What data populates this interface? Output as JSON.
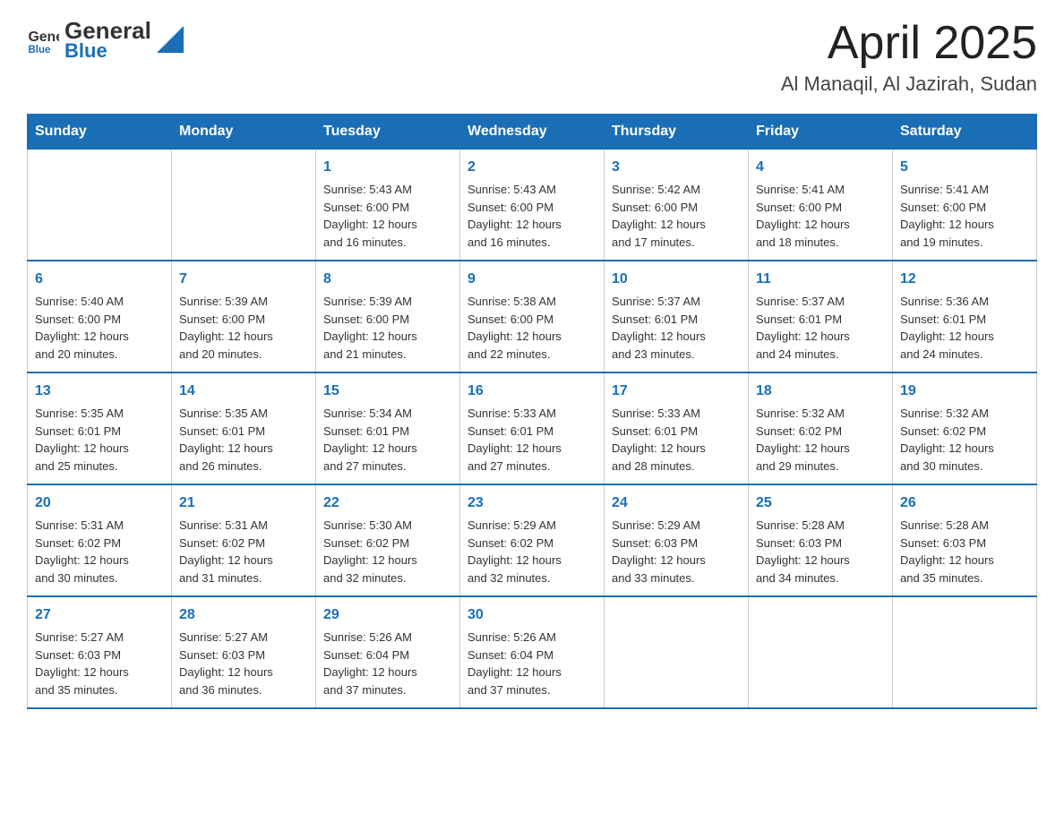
{
  "header": {
    "logo_text_general": "General",
    "logo_text_blue": "Blue",
    "month_title": "April 2025",
    "location": "Al Manaqil, Al Jazirah, Sudan"
  },
  "days_of_week": [
    "Sunday",
    "Monday",
    "Tuesday",
    "Wednesday",
    "Thursday",
    "Friday",
    "Saturday"
  ],
  "weeks": [
    [
      {
        "day": "",
        "info": ""
      },
      {
        "day": "",
        "info": ""
      },
      {
        "day": "1",
        "info": "Sunrise: 5:43 AM\nSunset: 6:00 PM\nDaylight: 12 hours\nand 16 minutes."
      },
      {
        "day": "2",
        "info": "Sunrise: 5:43 AM\nSunset: 6:00 PM\nDaylight: 12 hours\nand 16 minutes."
      },
      {
        "day": "3",
        "info": "Sunrise: 5:42 AM\nSunset: 6:00 PM\nDaylight: 12 hours\nand 17 minutes."
      },
      {
        "day": "4",
        "info": "Sunrise: 5:41 AM\nSunset: 6:00 PM\nDaylight: 12 hours\nand 18 minutes."
      },
      {
        "day": "5",
        "info": "Sunrise: 5:41 AM\nSunset: 6:00 PM\nDaylight: 12 hours\nand 19 minutes."
      }
    ],
    [
      {
        "day": "6",
        "info": "Sunrise: 5:40 AM\nSunset: 6:00 PM\nDaylight: 12 hours\nand 20 minutes."
      },
      {
        "day": "7",
        "info": "Sunrise: 5:39 AM\nSunset: 6:00 PM\nDaylight: 12 hours\nand 20 minutes."
      },
      {
        "day": "8",
        "info": "Sunrise: 5:39 AM\nSunset: 6:00 PM\nDaylight: 12 hours\nand 21 minutes."
      },
      {
        "day": "9",
        "info": "Sunrise: 5:38 AM\nSunset: 6:00 PM\nDaylight: 12 hours\nand 22 minutes."
      },
      {
        "day": "10",
        "info": "Sunrise: 5:37 AM\nSunset: 6:01 PM\nDaylight: 12 hours\nand 23 minutes."
      },
      {
        "day": "11",
        "info": "Sunrise: 5:37 AM\nSunset: 6:01 PM\nDaylight: 12 hours\nand 24 minutes."
      },
      {
        "day": "12",
        "info": "Sunrise: 5:36 AM\nSunset: 6:01 PM\nDaylight: 12 hours\nand 24 minutes."
      }
    ],
    [
      {
        "day": "13",
        "info": "Sunrise: 5:35 AM\nSunset: 6:01 PM\nDaylight: 12 hours\nand 25 minutes."
      },
      {
        "day": "14",
        "info": "Sunrise: 5:35 AM\nSunset: 6:01 PM\nDaylight: 12 hours\nand 26 minutes."
      },
      {
        "day": "15",
        "info": "Sunrise: 5:34 AM\nSunset: 6:01 PM\nDaylight: 12 hours\nand 27 minutes."
      },
      {
        "day": "16",
        "info": "Sunrise: 5:33 AM\nSunset: 6:01 PM\nDaylight: 12 hours\nand 27 minutes."
      },
      {
        "day": "17",
        "info": "Sunrise: 5:33 AM\nSunset: 6:01 PM\nDaylight: 12 hours\nand 28 minutes."
      },
      {
        "day": "18",
        "info": "Sunrise: 5:32 AM\nSunset: 6:02 PM\nDaylight: 12 hours\nand 29 minutes."
      },
      {
        "day": "19",
        "info": "Sunrise: 5:32 AM\nSunset: 6:02 PM\nDaylight: 12 hours\nand 30 minutes."
      }
    ],
    [
      {
        "day": "20",
        "info": "Sunrise: 5:31 AM\nSunset: 6:02 PM\nDaylight: 12 hours\nand 30 minutes."
      },
      {
        "day": "21",
        "info": "Sunrise: 5:31 AM\nSunset: 6:02 PM\nDaylight: 12 hours\nand 31 minutes."
      },
      {
        "day": "22",
        "info": "Sunrise: 5:30 AM\nSunset: 6:02 PM\nDaylight: 12 hours\nand 32 minutes."
      },
      {
        "day": "23",
        "info": "Sunrise: 5:29 AM\nSunset: 6:02 PM\nDaylight: 12 hours\nand 32 minutes."
      },
      {
        "day": "24",
        "info": "Sunrise: 5:29 AM\nSunset: 6:03 PM\nDaylight: 12 hours\nand 33 minutes."
      },
      {
        "day": "25",
        "info": "Sunrise: 5:28 AM\nSunset: 6:03 PM\nDaylight: 12 hours\nand 34 minutes."
      },
      {
        "day": "26",
        "info": "Sunrise: 5:28 AM\nSunset: 6:03 PM\nDaylight: 12 hours\nand 35 minutes."
      }
    ],
    [
      {
        "day": "27",
        "info": "Sunrise: 5:27 AM\nSunset: 6:03 PM\nDaylight: 12 hours\nand 35 minutes."
      },
      {
        "day": "28",
        "info": "Sunrise: 5:27 AM\nSunset: 6:03 PM\nDaylight: 12 hours\nand 36 minutes."
      },
      {
        "day": "29",
        "info": "Sunrise: 5:26 AM\nSunset: 6:04 PM\nDaylight: 12 hours\nand 37 minutes."
      },
      {
        "day": "30",
        "info": "Sunrise: 5:26 AM\nSunset: 6:04 PM\nDaylight: 12 hours\nand 37 minutes."
      },
      {
        "day": "",
        "info": ""
      },
      {
        "day": "",
        "info": ""
      },
      {
        "day": "",
        "info": ""
      }
    ]
  ]
}
